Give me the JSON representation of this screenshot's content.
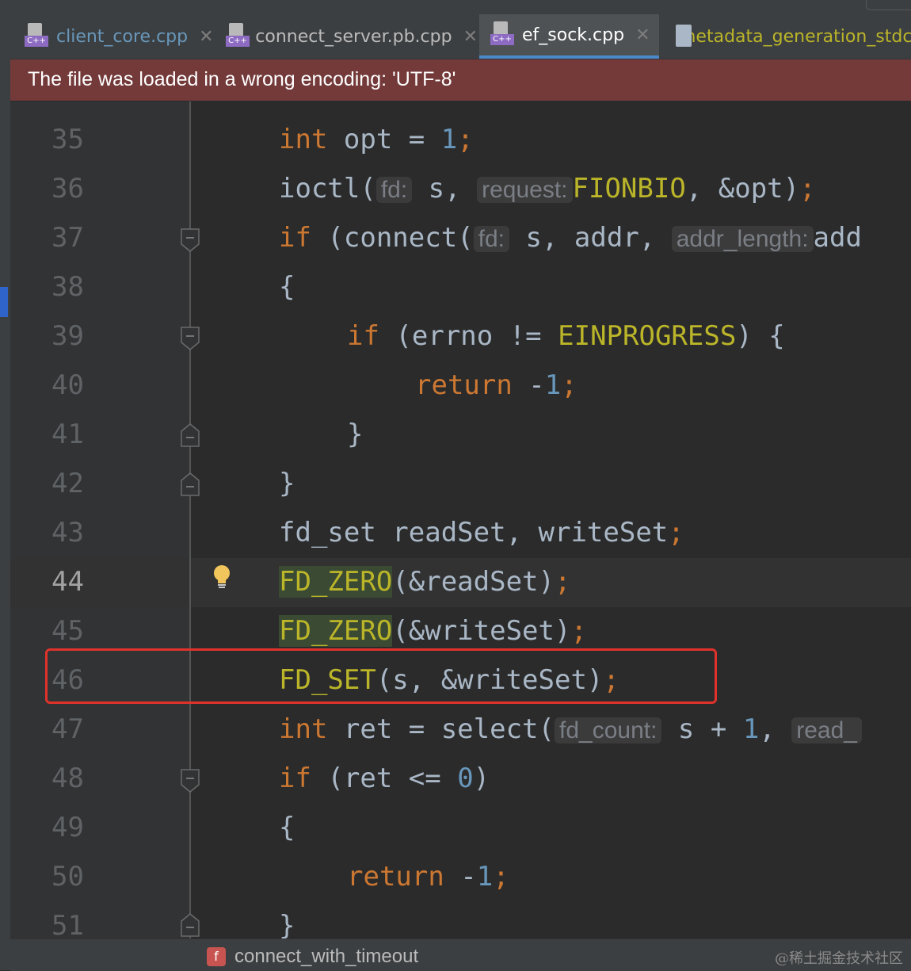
{
  "tabs": [
    {
      "label": "client_core.cpp",
      "color": "#6897bb",
      "icon": "cpp-file-icon",
      "badge": "C++",
      "closable": true
    },
    {
      "label": "connect_server.pb.cpp",
      "color": "#bbbbbb",
      "icon": "cpp-file-icon",
      "badge": "C++",
      "closable": true
    },
    {
      "label": "ef_sock.cpp",
      "color": "#ffffff",
      "icon": "cpp-file-icon",
      "badge": "C++",
      "closable": true,
      "active": true
    },
    {
      "label": "metadata_generation_stdc",
      "color": "#bbb529",
      "icon": "text-file-icon",
      "closable": false
    }
  ],
  "close_glyph": "✕",
  "banner": {
    "text": "The file was loaded in a wrong encoding: 'UTF-8'",
    "color": "#743a3a"
  },
  "line_numbers": [
    "35",
    "36",
    "37",
    "38",
    "39",
    "40",
    "41",
    "42",
    "43",
    "44",
    "45",
    "46",
    "47",
    "48",
    "49",
    "50",
    "51"
  ],
  "current_line": "44",
  "code": {
    "l35": {
      "kw": "int",
      "rest": " opt = ",
      "num": "1",
      "end": ";"
    },
    "l36": {
      "fn": "ioctl(",
      "hint1": "fd:",
      "a1": "s,",
      "hint2": "request:",
      "mac": "FIONBIO",
      "rest": ", &opt)",
      "end": ";"
    },
    "l37": {
      "kw": "if",
      "fn": " (connect(",
      "hint1": "fd:",
      "a1": "s, addr, ",
      "hint2": "addr_length:",
      "a2": "add"
    },
    "l38": {
      "text": "{"
    },
    "l39": {
      "kw": "if",
      "rest": " (errno != ",
      "mac": "EINPROGRESS",
      "end": ") {"
    },
    "l40": {
      "kw": "return",
      "rest": " -",
      "num": "1",
      "end": ";"
    },
    "l41": {
      "text": "}"
    },
    "l42": {
      "text": "}"
    },
    "l43": {
      "rest": "fd_set readSet, writeSet",
      "end": ";"
    },
    "l44": {
      "mac": "FD_ZERO",
      "rest": "(&readSet)",
      "end": ";"
    },
    "l45": {
      "mac": "FD_ZERO",
      "rest": "(&writeSet)",
      "end": ";"
    },
    "l46": {
      "mac": "FD_SET",
      "rest": "(s, &writeSet)",
      "end": ";"
    },
    "l47": {
      "kw": "int",
      "rest": " ret = select(",
      "hint1": "fd_count:",
      "a1": "s + ",
      "num": "1",
      "a2": ", ",
      "hint2": "read_"
    },
    "l48": {
      "kw": "if",
      "rest": " (ret <= ",
      "num": "0",
      "end": ")"
    },
    "l49": {
      "text": "{"
    },
    "l50": {
      "kw": "return",
      "rest": " -",
      "num": "1",
      "end": ";"
    },
    "l51": {
      "text": "}"
    }
  },
  "status": {
    "badge": "f",
    "function_name": "connect_with_timeout",
    "watermark": "@稀土掘金技术社区"
  },
  "colors": {
    "keyword": "#cc7832",
    "number": "#6897bb",
    "macro": "#bbb529",
    "text": "#a9b7c6",
    "highlight_box": "#e0322b"
  }
}
